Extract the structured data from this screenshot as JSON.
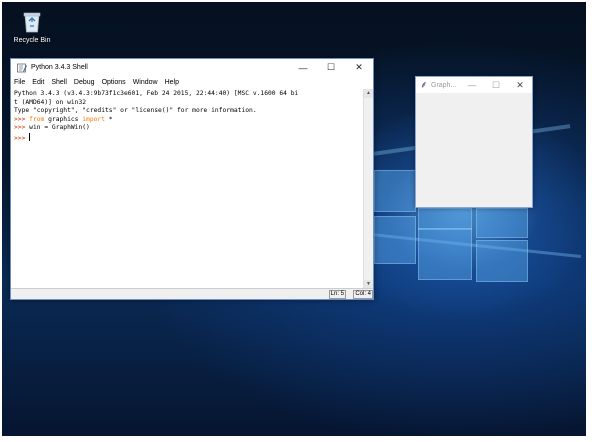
{
  "desktop": {
    "recycle_bin_label": "Recycle Bin"
  },
  "shell_window": {
    "title": "Python 3.4.3 Shell",
    "minimize": "—",
    "maximize": "☐",
    "close": "✕",
    "menu": [
      "File",
      "Edit",
      "Shell",
      "Debug",
      "Options",
      "Window",
      "Help"
    ],
    "lines": {
      "banner1": "Python 3.4.3 (v3.4.3:9b73f1c3e601, Feb 24 2015, 22:44:40) [MSC v.1600 64 bi",
      "banner2": "t (AMD64)] on win32",
      "banner3": "Type \"copyright\", \"credits\" or \"license()\" for more information.",
      "prompt": ">>>",
      "line4_kw1": "from",
      "line4_mod": " graphics ",
      "line4_kw2": "import",
      "line4_rest": " *",
      "line5_code": " win = GraphWin()"
    },
    "status": {
      "line": "Ln: 5",
      "col": "Col: 4"
    }
  },
  "graph_window": {
    "title": "Graph...",
    "minimize": "—",
    "maximize": "☐",
    "close": "✕"
  }
}
